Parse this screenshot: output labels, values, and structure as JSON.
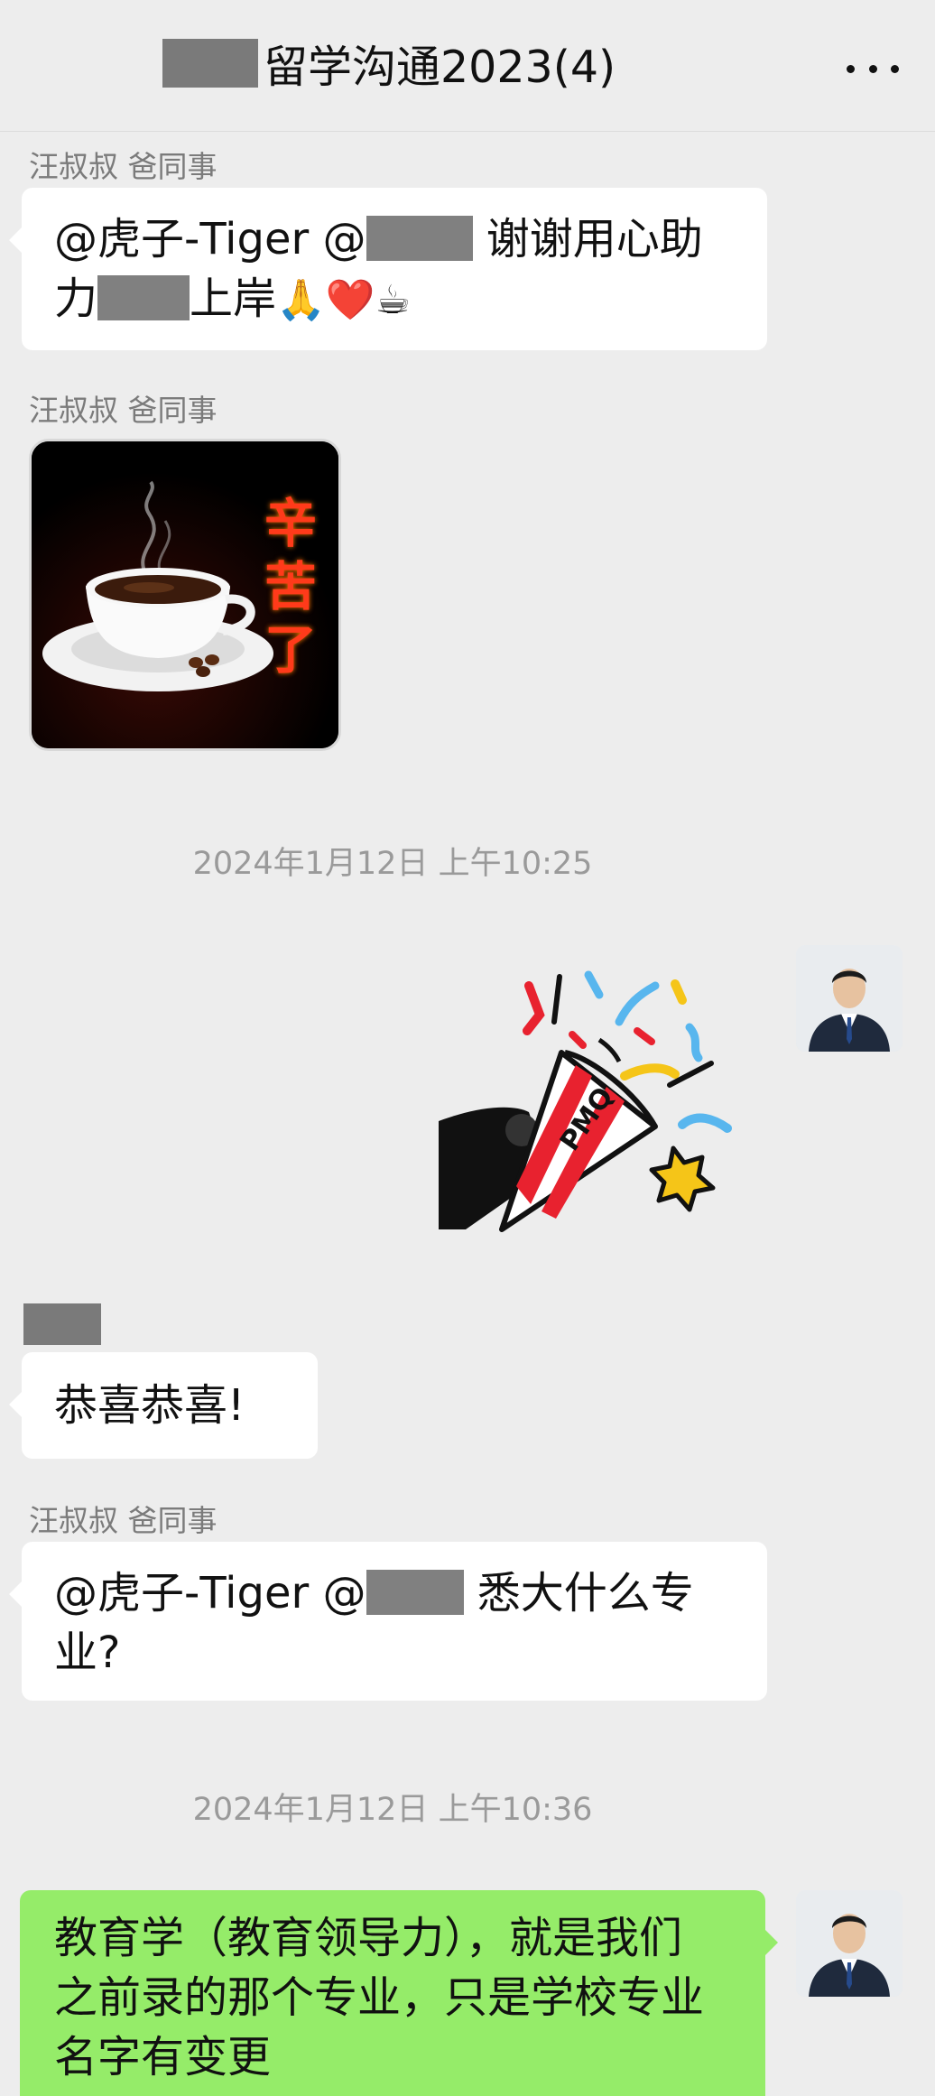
{
  "header": {
    "title": "留学沟通2023(4)",
    "more_icon": "more-dots-icon"
  },
  "messages": [
    {
      "sender": "汪叔叔 爸同事",
      "line1_a": "@虎子-Tiger @",
      "line1_b": " 谢谢用心助",
      "line2_a": "力",
      "line2_b": "上岸",
      "emojis": "🙏❤️☕"
    },
    {
      "sender": "汪叔叔 爸同事",
      "sticker_text": "辛苦了"
    },
    {
      "time": "2024年1月12日 上午10:25"
    },
    {
      "sticker_text": "PMQ"
    },
    {
      "text": "恭喜恭喜!"
    },
    {
      "sender": "汪叔叔 爸同事",
      "line1_a": "@虎子-Tiger @",
      "line1_b": " 悉大什么专",
      "line2": "业?"
    },
    {
      "time": "2024年1月12日 上午10:36"
    },
    {
      "line1": "教育学（教育领导力），就是我们",
      "line2": "之前录的那个专业，只是学校专业",
      "line3": "名字有变更"
    }
  ]
}
